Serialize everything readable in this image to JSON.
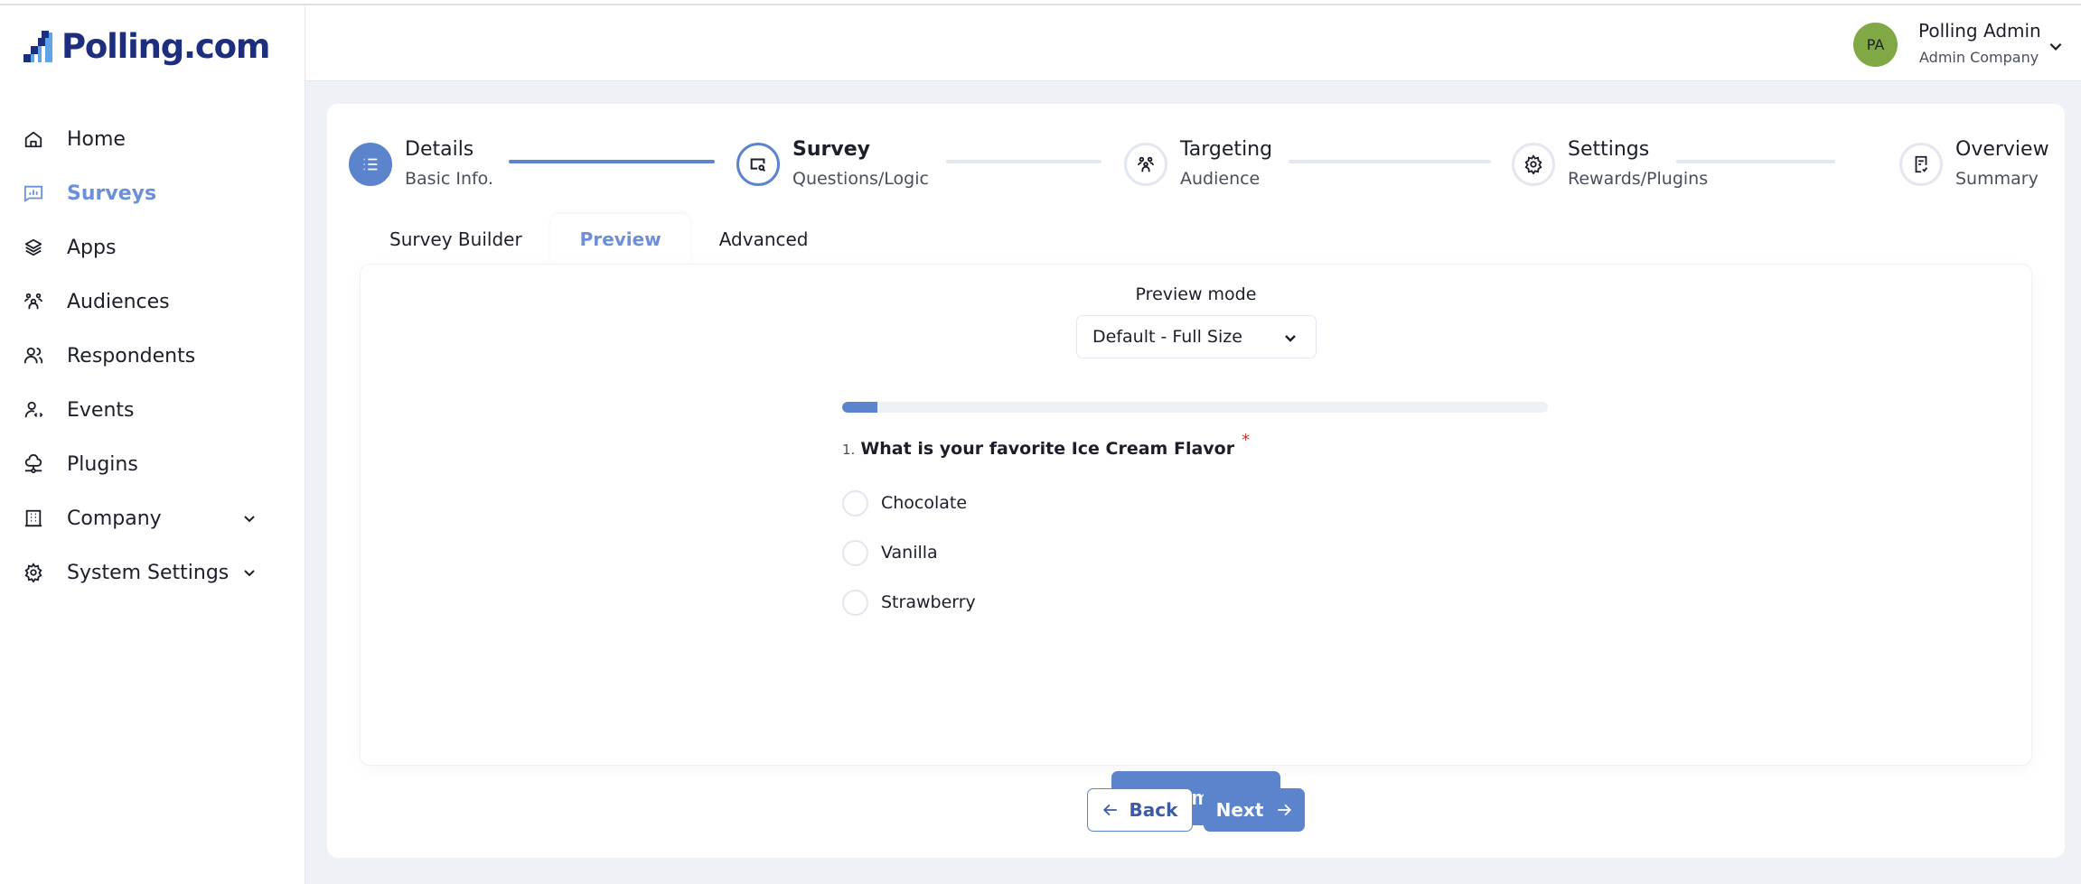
{
  "app": {
    "brand": "Polling.com"
  },
  "sidebar": {
    "items": [
      {
        "label": "Home",
        "icon": "home-icon",
        "active": false
      },
      {
        "label": "Surveys",
        "icon": "survey-chart-icon",
        "active": true
      },
      {
        "label": "Apps",
        "icon": "layers-icon",
        "active": false
      },
      {
        "label": "Audiences",
        "icon": "audience-icon",
        "active": false
      },
      {
        "label": "Respondents",
        "icon": "users-icon",
        "active": false
      },
      {
        "label": "Events",
        "icon": "user-code-icon",
        "active": false
      },
      {
        "label": "Plugins",
        "icon": "cloud-network-icon",
        "active": false
      },
      {
        "label": "Company",
        "icon": "building-icon",
        "active": false,
        "expandable": true
      },
      {
        "label": "System Settings",
        "icon": "gear-icon",
        "active": false,
        "expandable": true
      }
    ]
  },
  "header": {
    "user": {
      "initials": "PA",
      "name": "Polling Admin",
      "company": "Admin Company",
      "avatar_color": "#80a845"
    }
  },
  "stepper": {
    "steps": [
      {
        "title": "Details",
        "subtitle": "Basic Info.",
        "state": "done",
        "icon": "list-icon"
      },
      {
        "title": "Survey",
        "subtitle": "Questions/Logic",
        "state": "current",
        "icon": "screen-search-icon"
      },
      {
        "title": "Targeting",
        "subtitle": "Audience",
        "state": "pending",
        "icon": "audience-icon"
      },
      {
        "title": "Settings",
        "subtitle": "Rewards/Plugins",
        "state": "pending",
        "icon": "gear-icon"
      },
      {
        "title": "Overview",
        "subtitle": "Summary",
        "state": "pending",
        "icon": "document-check-icon"
      }
    ]
  },
  "tabs": [
    {
      "label": "Survey Builder",
      "active": false
    },
    {
      "label": "Preview",
      "active": true
    },
    {
      "label": "Advanced",
      "active": false
    }
  ],
  "preview": {
    "mode_label": "Preview mode",
    "mode_value": "Default - Full Size",
    "progress_percent": 5,
    "question": {
      "number": "1.",
      "text": "What is your favorite Ice Cream Flavor",
      "required_marker": "*",
      "options": [
        "Chocolate",
        "Vanilla",
        "Strawberry"
      ]
    },
    "complete_label": "Complete"
  },
  "footer": {
    "back_label": "Back",
    "next_label": "Next"
  },
  "colors": {
    "accent": "#5b84cc",
    "accent_text": "#6b8fd9",
    "brand": "#1e2e7e",
    "required": "#c8342f",
    "background": "#eef1f6"
  }
}
